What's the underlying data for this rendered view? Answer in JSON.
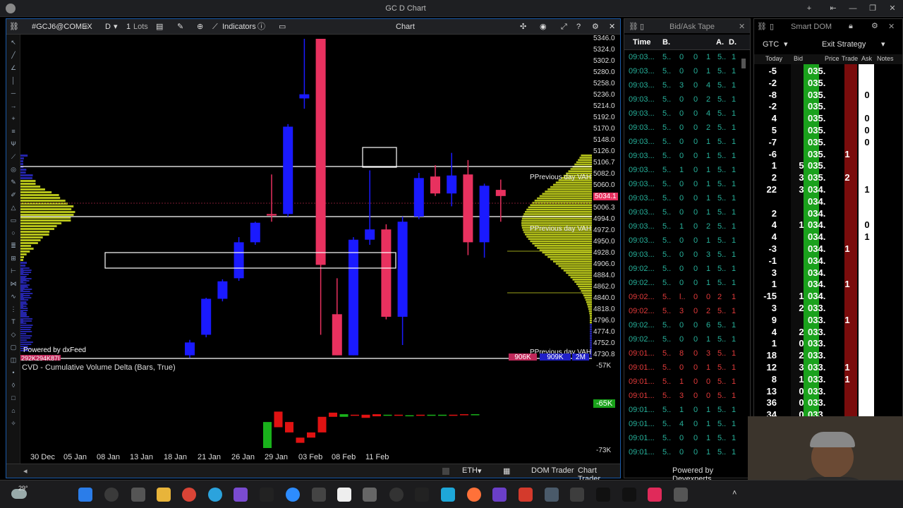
{
  "window": {
    "title": "GC D Chart"
  },
  "chart": {
    "toolbar": {
      "symbol": "#GCJ6@COMEX",
      "timeframe": "D",
      "lots_value": "1",
      "lots_label": "Lots",
      "indicators_label": "Indicators",
      "panel_title": "Chart"
    },
    "price_axis": [
      "5346.0",
      "5324.0",
      "5302.0",
      "5280.0",
      "5258.0",
      "5236.0",
      "5214.0",
      "5192.0",
      "5170.0",
      "5148.0",
      "5126.0",
      "5106.7",
      "5082.0",
      "5060.0",
      "5034.1",
      "5006.3",
      "4994.0",
      "4972.0",
      "4950.0",
      "4928.0",
      "4906.0",
      "4884.0",
      "4862.0",
      "4840.0",
      "4818.0",
      "4796.0",
      "4774.0",
      "4752.0",
      "4730.8"
    ],
    "current_price": "5034.1",
    "labels": {
      "vah1": "PPrevious day VAH",
      "vah2": "PPrevious day VAH",
      "vah3": "PPrevious day VAH",
      "powered": "Powered by dxFeed",
      "vol_left": "292K294K87I",
      "vol_a": "906K",
      "vol_b": "909K",
      "vol_c": "2M"
    },
    "cvd": {
      "title": "CVD - Cumulative Volume Delta (Bars, True)",
      "axis_top": "-57K",
      "axis_mid": "-65K",
      "axis_bottom": "-73K"
    },
    "dates": [
      "30 Dec",
      "05 Jan",
      "08 Jan",
      "13 Jan",
      "18 Jan",
      "21 Jan",
      "26 Jan",
      "29 Jan",
      "03 Feb",
      "08 Feb",
      "11 Feb"
    ],
    "bottom": {
      "session": "ETH",
      "dom_trader": "DOM Trader",
      "chart_trader": "Chart Trader"
    },
    "colors": {
      "up": "#1a1aff",
      "down": "#e8315f",
      "profile": "#b5c21a",
      "cvd_up": "#19b21b",
      "cvd_down": "#e01212"
    }
  },
  "chart_data": {
    "type": "candlestick",
    "symbol": "#GCJ6@COMEX",
    "timeframe": "D",
    "ylim": [
      4730.8,
      5346.0
    ],
    "candles": [
      {
        "o": 4730,
        "h": 4760,
        "l": 4725,
        "c": 4755
      },
      {
        "o": 4770,
        "h": 4842,
        "l": 4765,
        "c": 4840
      },
      {
        "o": 4840,
        "h": 4878,
        "l": 4835,
        "c": 4874
      },
      {
        "o": 4880,
        "h": 4960,
        "l": 4875,
        "c": 4950
      },
      {
        "o": 4950,
        "h": 4990,
        "l": 4945,
        "c": 4988
      },
      {
        "o": 5005,
        "h": 5082,
        "l": 4990,
        "c": 5002
      },
      {
        "o": 5005,
        "h": 5180,
        "l": 5000,
        "c": 5175
      },
      {
        "o": 5230,
        "h": 5346,
        "l": 5210,
        "c": 5238
      },
      {
        "o": 5346,
        "h": 5346,
        "l": 4770,
        "c": 4906
      },
      {
        "o": 4810,
        "h": 4880,
        "l": 4730,
        "c": 4730
      },
      {
        "o": 4730,
        "h": 4960,
        "l": 4730,
        "c": 4955
      },
      {
        "o": 4955,
        "h": 5090,
        "l": 4945,
        "c": 4975
      },
      {
        "o": 4975,
        "h": 4985,
        "l": 4800,
        "c": 4805
      },
      {
        "o": 4805,
        "h": 5000,
        "l": 4750,
        "c": 4990
      },
      {
        "o": 5000,
        "h": 5085,
        "l": 4995,
        "c": 5075
      },
      {
        "o": 5078,
        "h": 5100,
        "l": 5040,
        "c": 5045
      },
      {
        "o": 5045,
        "h": 5124,
        "l": 5020,
        "c": 5080
      },
      {
        "o": 5082,
        "h": 5110,
        "l": 4925,
        "c": 4950
      },
      {
        "o": 4950,
        "h": 5064,
        "l": 4920,
        "c": 5060
      },
      {
        "o": 5052,
        "h": 5072,
        "l": 4990,
        "c": 5040
      }
    ],
    "cvd_ylim": [
      -73,
      -57
    ],
    "cvd_values": [
      -68,
      -69,
      -70,
      -72,
      -71,
      -70,
      -67,
      -66.5,
      -66.8,
      -67.2,
      -66.9,
      -66.6,
      -66.8,
      -66.7,
      -66.7,
      -66.6,
      -66.6,
      -66.7,
      -66.6,
      -66.5
    ],
    "cvd_opens": [
      -73,
      -66,
      -68,
      -71,
      -70,
      -67,
      -66.2,
      -67,
      -66.6,
      -66.6,
      -66.5,
      -66.8,
      -66.6,
      -66.7,
      -66.6,
      -66.7,
      -66.6,
      -66.6,
      -66.5,
      -66.6
    ]
  },
  "tape": {
    "title": "Bid/Ask Tape",
    "cols": [
      "Time",
      "B.",
      "A.",
      "D."
    ],
    "rows": [
      {
        "t": "09:03...",
        "p": "5..",
        "v": [
          "0",
          "0",
          "1",
          "5..",
          "1"
        ],
        "c": "green"
      },
      {
        "t": "09:03...",
        "p": "5..",
        "v": [
          "0",
          "0",
          "1",
          "5..",
          "1"
        ],
        "c": "green"
      },
      {
        "t": "09:03...",
        "p": "5..",
        "v": [
          "3",
          "0",
          "4",
          "5..",
          "1"
        ],
        "c": "green"
      },
      {
        "t": "09:03...",
        "p": "5..",
        "v": [
          "0",
          "0",
          "2",
          "5..",
          "1"
        ],
        "c": "green"
      },
      {
        "t": "09:03...",
        "p": "5..",
        "v": [
          "0",
          "0",
          "4",
          "5..",
          "1"
        ],
        "c": "green"
      },
      {
        "t": "09:03...",
        "p": "5..",
        "v": [
          "0",
          "0",
          "2",
          "5..",
          "1"
        ],
        "c": "green"
      },
      {
        "t": "09:03...",
        "p": "5..",
        "v": [
          "0",
          "0",
          "1",
          "5..",
          "1"
        ],
        "c": "green"
      },
      {
        "t": "09:03...",
        "p": "5..",
        "v": [
          "0",
          "0",
          "1",
          "5..",
          "1"
        ],
        "c": "green"
      },
      {
        "t": "09:03...",
        "p": "5..",
        "v": [
          "1",
          "0",
          "1",
          "5..",
          "1"
        ],
        "c": "green"
      },
      {
        "t": "09:03...",
        "p": "5..",
        "v": [
          "0",
          "0",
          "1",
          "5..",
          "1"
        ],
        "c": "green"
      },
      {
        "t": "09:03...",
        "p": "5..",
        "v": [
          "0",
          "0",
          "1",
          "5..",
          "1"
        ],
        "c": "green"
      },
      {
        "t": "09:03...",
        "p": "5..",
        "v": [
          "0",
          "0",
          "1",
          "5..",
          "1"
        ],
        "c": "green"
      },
      {
        "t": "09:03...",
        "p": "5..",
        "v": [
          "1",
          "0",
          "2",
          "5..",
          "1"
        ],
        "c": "green"
      },
      {
        "t": "09:03...",
        "p": "5..",
        "v": [
          "0",
          "0",
          "1",
          "5..",
          "1"
        ],
        "c": "green"
      },
      {
        "t": "09:03...",
        "p": "5..",
        "v": [
          "0",
          "0",
          "3",
          "5..",
          "1"
        ],
        "c": "green"
      },
      {
        "t": "09:02...",
        "p": "5..",
        "v": [
          "0",
          "0",
          "1",
          "5..",
          "1"
        ],
        "c": "green"
      },
      {
        "t": "09:02...",
        "p": "5..",
        "v": [
          "0",
          "0",
          "1",
          "5..",
          "1"
        ],
        "c": "green"
      },
      {
        "t": "09:02...",
        "p": "5..",
        "v": [
          "l..",
          "0",
          "0",
          "2",
          "1"
        ],
        "c": "red"
      },
      {
        "t": "09:02...",
        "p": "5..",
        "v": [
          "3",
          "0",
          "2",
          "5..",
          "1"
        ],
        "c": "red"
      },
      {
        "t": "09:02...",
        "p": "5..",
        "v": [
          "0",
          "0",
          "6",
          "5..",
          "1"
        ],
        "c": "green"
      },
      {
        "t": "09:02...",
        "p": "5..",
        "v": [
          "0",
          "0",
          "1",
          "5..",
          "1"
        ],
        "c": "green"
      },
      {
        "t": "09:01...",
        "p": "5..",
        "v": [
          "8",
          "0",
          "3",
          "5..",
          "1"
        ],
        "c": "red"
      },
      {
        "t": "09:01...",
        "p": "5..",
        "v": [
          "0",
          "0",
          "1",
          "5..",
          "1"
        ],
        "c": "red"
      },
      {
        "t": "09:01...",
        "p": "5..",
        "v": [
          "1",
          "0",
          "0",
          "5..",
          "1"
        ],
        "c": "red"
      },
      {
        "t": "09:01...",
        "p": "5..",
        "v": [
          "3",
          "0",
          "0",
          "5..",
          "1"
        ],
        "c": "red"
      },
      {
        "t": "09:01...",
        "p": "5..",
        "v": [
          "1",
          "0",
          "1",
          "5..",
          "1"
        ],
        "c": "green"
      },
      {
        "t": "09:01...",
        "p": "5..",
        "v": [
          "4",
          "0",
          "1",
          "5..",
          "1"
        ],
        "c": "green"
      },
      {
        "t": "09:01...",
        "p": "5..",
        "v": [
          "0",
          "0",
          "1",
          "5..",
          "1"
        ],
        "c": "green"
      },
      {
        "t": "09:01...",
        "p": "5..",
        "v": [
          "0",
          "0",
          "1",
          "5..",
          "1"
        ],
        "c": "green"
      }
    ],
    "footer": "Powered by Devexperts"
  },
  "dom": {
    "title": "Smart DOM",
    "tif": "GTC",
    "strategy": "Exit Strategy",
    "cols": [
      "Today",
      "Bid",
      "Price",
      "Trade",
      "Ask",
      "Notes"
    ],
    "rows": [
      {
        "today": "-5",
        "bid": "",
        "price": "035.",
        "trade": "",
        "ask": ""
      },
      {
        "today": "-2",
        "bid": "",
        "price": "035.",
        "trade": "",
        "ask": ""
      },
      {
        "today": "-8",
        "bid": "",
        "price": "035.",
        "trade": "",
        "ask": "0"
      },
      {
        "today": "-2",
        "bid": "",
        "price": "035.",
        "trade": "",
        "ask": ""
      },
      {
        "today": "4",
        "bid": "",
        "price": "035.",
        "trade": "",
        "ask": "0"
      },
      {
        "today": "5",
        "bid": "",
        "price": "035.",
        "trade": "",
        "ask": "0"
      },
      {
        "today": "-7",
        "bid": "",
        "price": "035.",
        "trade": "",
        "ask": "0"
      },
      {
        "today": "-6",
        "bid": "",
        "price": "035.",
        "trade": "1",
        "ask": ""
      },
      {
        "today": "1",
        "bid": "5",
        "price": "035.",
        "trade": "",
        "ask": ""
      },
      {
        "today": "2",
        "bid": "3",
        "price": "035.",
        "trade": "2",
        "ask": ""
      },
      {
        "today": "22",
        "bid": "3",
        "price": "034.",
        "trade": "",
        "ask": "1"
      },
      {
        "today": "",
        "bid": "",
        "price": "034.",
        "trade": "",
        "ask": ""
      },
      {
        "today": "2",
        "bid": "",
        "price": "034.",
        "trade": "",
        "ask": ""
      },
      {
        "today": "4",
        "bid": "1",
        "price": "034.",
        "trade": "",
        "ask": "0"
      },
      {
        "today": "4",
        "bid": "",
        "price": "034.",
        "trade": "",
        "ask": "1"
      },
      {
        "today": "-3",
        "bid": "",
        "price": "034.",
        "trade": "1",
        "ask": ""
      },
      {
        "today": "-1",
        "bid": "",
        "price": "034.",
        "trade": "",
        "ask": ""
      },
      {
        "today": "3",
        "bid": "",
        "price": "034.",
        "trade": "",
        "ask": ""
      },
      {
        "today": "1",
        "bid": "",
        "price": "034.",
        "trade": "1",
        "ask": ""
      },
      {
        "today": "-15",
        "bid": "1",
        "price": "034.",
        "trade": "",
        "ask": ""
      },
      {
        "today": "3",
        "bid": "2",
        "price": "033.",
        "trade": "",
        "ask": ""
      },
      {
        "today": "9",
        "bid": "",
        "price": "033.",
        "trade": "1",
        "ask": ""
      },
      {
        "today": "4",
        "bid": "2",
        "price": "033.",
        "trade": "",
        "ask": ""
      },
      {
        "today": "1",
        "bid": "0",
        "price": "033.",
        "trade": "",
        "ask": ""
      },
      {
        "today": "18",
        "bid": "2",
        "price": "033.",
        "trade": "",
        "ask": ""
      },
      {
        "today": "12",
        "bid": "3",
        "price": "033.",
        "trade": "1",
        "ask": ""
      },
      {
        "today": "8",
        "bid": "1",
        "price": "033.",
        "trade": "1",
        "ask": ""
      },
      {
        "today": "13",
        "bid": "0",
        "price": "033.",
        "trade": "",
        "ask": ""
      },
      {
        "today": "36",
        "bid": "0",
        "price": "033.",
        "trade": "",
        "ask": ""
      },
      {
        "today": "34",
        "bid": "0",
        "price": "033.",
        "trade": "",
        "ask": ""
      }
    ]
  },
  "taskbar": {
    "temp": "29°"
  }
}
